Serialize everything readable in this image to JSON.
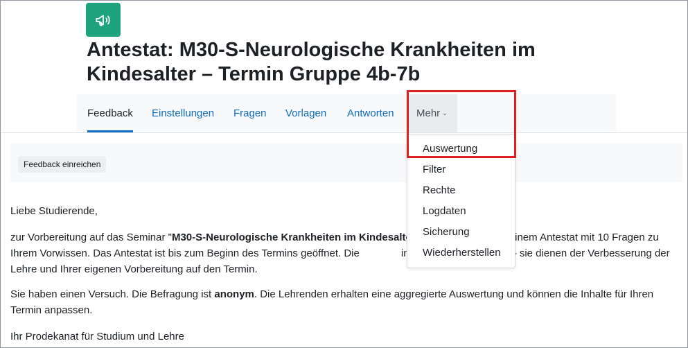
{
  "page": {
    "title": "Antestat: M30-S-Neurologische Krankheiten im Kindesalter – Termin Gruppe 4b-7b",
    "icon": "megaphone-icon",
    "accent_color": "#1fa37f"
  },
  "nav": {
    "tabs": [
      {
        "label": "Feedback",
        "active": true
      },
      {
        "label": "Einstellungen"
      },
      {
        "label": "Fragen"
      },
      {
        "label": "Vorlagen"
      },
      {
        "label": "Antworten"
      },
      {
        "label": "Mehr"
      }
    ]
  },
  "dropdown": {
    "items": [
      "Auswertung",
      "Filter",
      "Rechte",
      "Logdaten",
      "Sicherung",
      "Wiederherstellen"
    ],
    "highlighted": "Auswertung",
    "highlight_color": "#e02020"
  },
  "action_bar": {
    "button_label": "Feedback einreichen"
  },
  "content": {
    "greeting": "Liebe Studierende,",
    "p2_before": "zur Vorbereitung auf das Seminar \"",
    "p2_bold": "M30-S-Neurologische Krankheiten im Kindesalte",
    "p2_mid": "nahme an einem Antestat mit 10 Fragen zu Ihrem Vorwissen. Das Antestat ist bis zum Beginn des Termins geöffnet. Die",
    "p2_after": "in die Notengebung ein – sie dienen der Verbesserung der Lehre und Ihrer eigenen Vorbereitung auf den Termin.",
    "p3_before": "Sie haben einen Versuch. Die Befragung ist ",
    "p3_bold": "anonym",
    "p3_after": ". Die Lehrenden erhalten eine aggregierte Auswertung und können die Inhalte für Ihren Termin anpassen.",
    "signature": "Ihr Prodekanat für Studium und Lehre"
  }
}
